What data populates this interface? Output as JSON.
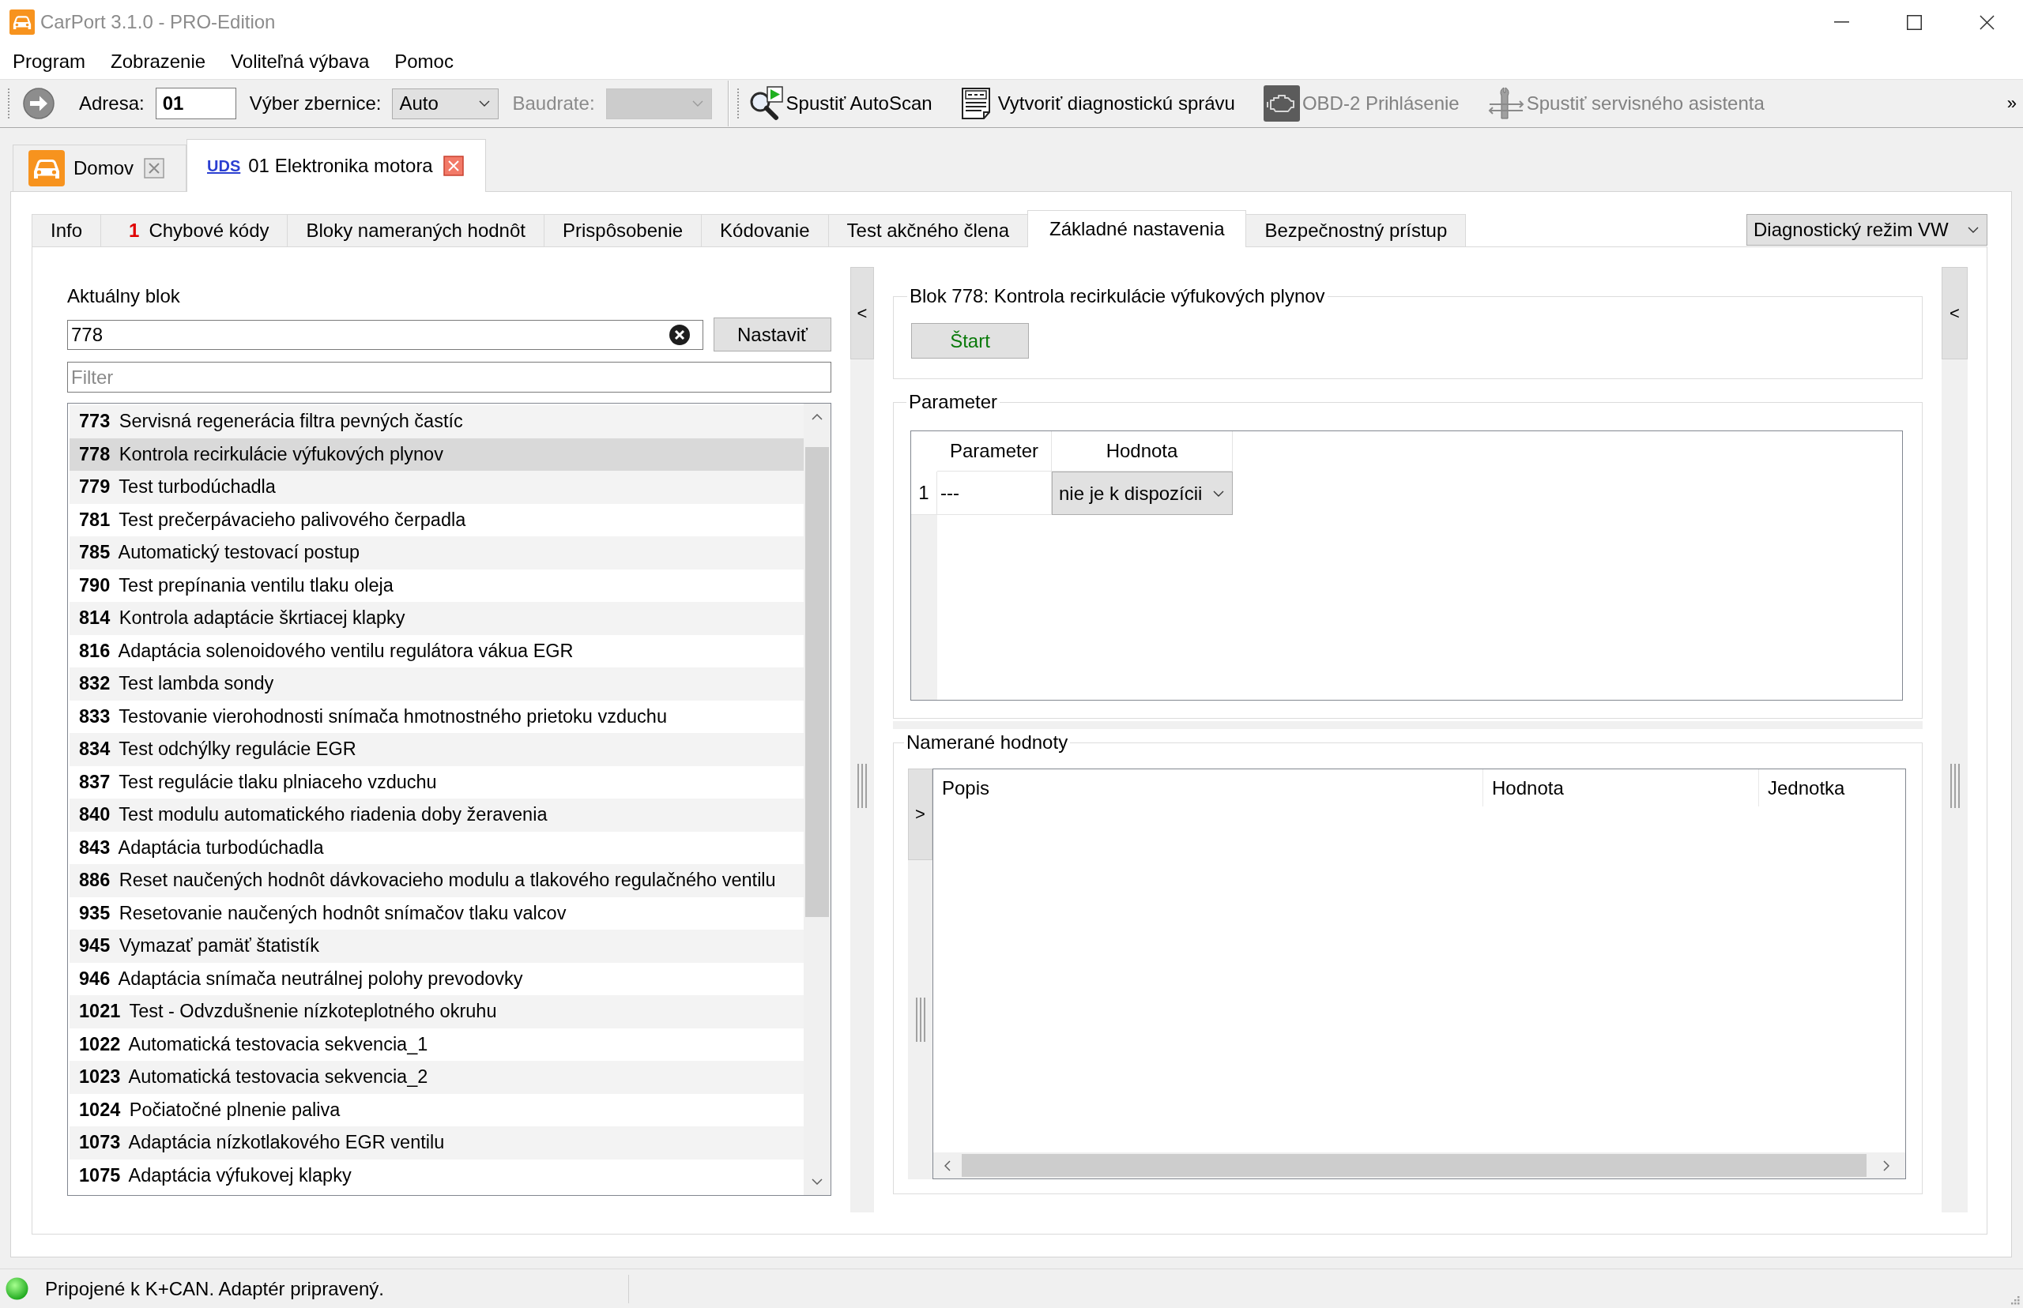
{
  "window": {
    "title": "CarPort 3.1.0 - PRO-Edition"
  },
  "menu": [
    "Program",
    "Zobrazenie",
    "Voliteľná výbava",
    "Pomoc"
  ],
  "toolbar": {
    "address": {
      "label": "Adresa:",
      "value": "01"
    },
    "bus": {
      "label": "Výber zbernice:",
      "value": "Auto"
    },
    "baudrate": {
      "label": "Baudrate:",
      "disabled": true
    },
    "actions": [
      {
        "kind": "autoscan",
        "label": "Spustiť AutoScan",
        "disabled": false
      },
      {
        "kind": "report",
        "label": "Vytvoriť diagnostickú správu",
        "disabled": false
      },
      {
        "kind": "obd",
        "label": "OBD-2 Prihlásenie",
        "disabled": true
      },
      {
        "kind": "assistant",
        "label": "Spustiť servisného asistenta",
        "disabled": true
      }
    ],
    "overflow": "»"
  },
  "document_tabs": [
    {
      "kind": "home",
      "label": "Domov",
      "selected": false
    },
    {
      "kind": "module",
      "protocol": "UDS",
      "label": "01 Elektronika motora",
      "selected": true
    }
  ],
  "tabs": [
    {
      "label": "Info",
      "selected": false
    },
    {
      "count": "1",
      "label": "Chybové kódy",
      "selected": false
    },
    {
      "label": "Bloky nameraných hodnôt",
      "selected": false
    },
    {
      "label": "Prispôsobenie",
      "selected": false
    },
    {
      "label": "Kódovanie",
      "selected": false
    },
    {
      "label": "Test akčného člena",
      "selected": false
    },
    {
      "label": "Základné nastavenia",
      "selected": true
    },
    {
      "label": "Bezpečnostný prístup",
      "selected": false
    }
  ],
  "mode_dropdown": {
    "value": "Diagnostický režim VW"
  },
  "current_block": {
    "label": "Aktuálny blok",
    "value": "778",
    "button": "Nastaviť"
  },
  "filter": {
    "placeholder": "Filter"
  },
  "blocks": [
    {
      "number": "773",
      "name": "Servisná regenerácia filtra pevných častíc",
      "selected": false
    },
    {
      "number": "778",
      "name": "Kontrola recirkulácie výfukových plynov",
      "selected": true
    },
    {
      "number": "779",
      "name": "Test turbodúchadla",
      "selected": false
    },
    {
      "number": "781",
      "name": "Test prečerpávacieho palivového čerpadla",
      "selected": false
    },
    {
      "number": "785",
      "name": "Automatický testovací postup",
      "selected": false
    },
    {
      "number": "790",
      "name": "Test prepínania ventilu tlaku oleja",
      "selected": false
    },
    {
      "number": "814",
      "name": "Kontrola adaptácie škrtiacej klapky",
      "selected": false
    },
    {
      "number": "816",
      "name": "Adaptácia solenoidového ventilu regulátora vákua EGR",
      "selected": false
    },
    {
      "number": "832",
      "name": "Test lambda sondy",
      "selected": false
    },
    {
      "number": "833",
      "name": "Testovanie vierohodnosti snímača hmotnostného prietoku vzduchu",
      "selected": false
    },
    {
      "number": "834",
      "name": "Test odchýlky regulácie EGR",
      "selected": false
    },
    {
      "number": "837",
      "name": "Test regulácie tlaku plniaceho vzduchu",
      "selected": false
    },
    {
      "number": "840",
      "name": "Test modulu automatického riadenia doby žeravenia",
      "selected": false
    },
    {
      "number": "843",
      "name": "Adaptácia turbodúchadla",
      "selected": false
    },
    {
      "number": "886",
      "name": "Reset naučených hodnôt dávkovacieho modulu a tlakového regulačného ventilu",
      "selected": false
    },
    {
      "number": "935",
      "name": "Resetovanie naučených hodnôt snímačov tlaku valcov",
      "selected": false
    },
    {
      "number": "945",
      "name": "Vymazať pamäť štatistík",
      "selected": false
    },
    {
      "number": "946",
      "name": "Adaptácia snímača neutrálnej polohy prevodovky",
      "selected": false
    },
    {
      "number": "1021",
      "name": "Test - Odvzdušnenie nízkoteplotného okruhu",
      "selected": false
    },
    {
      "number": "1022",
      "name": "Automatická testovacia sekvencia_1",
      "selected": false
    },
    {
      "number": "1023",
      "name": "Automatická testovacia sekvencia_2",
      "selected": false
    },
    {
      "number": "1024",
      "name": "Počiatočné plnenie paliva",
      "selected": false
    },
    {
      "number": "1073",
      "name": "Adaptácia nízkotlakového EGR ventilu",
      "selected": false
    },
    {
      "number": "1075",
      "name": "Adaptácia výfukovej klapky",
      "selected": false
    }
  ],
  "left_collapse": "<",
  "block_group": {
    "title": "Blok 778: Kontrola recirkulácie výfukových plynov",
    "button": "Štart"
  },
  "parameters": {
    "title": "Parameter",
    "columns": [
      "Parameter",
      "Hodnota"
    ],
    "rows": [
      {
        "index": "1",
        "parameter": "---",
        "value": "nie je k dispozícii"
      }
    ]
  },
  "measured_values": {
    "title": "Namerané hodnoty",
    "expand": ">",
    "columns": [
      "Popis",
      "Hodnota",
      "Jednotka"
    ]
  },
  "right_collapse": "<",
  "status_bar": {
    "connected": true,
    "text": "Pripojené k K+CAN. Adaptér pripravený."
  }
}
